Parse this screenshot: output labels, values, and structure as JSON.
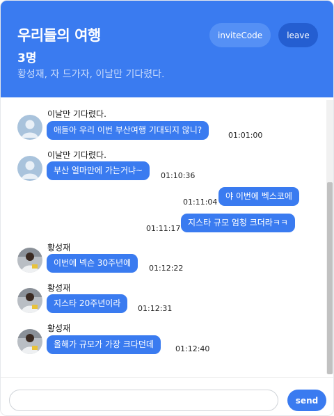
{
  "header": {
    "title": "우리들의 여행",
    "member_count": "3명",
    "members": "황성재, 자 드가자, 이날만 기다렸다.",
    "invite_label": "inviteCode",
    "leave_label": "leave"
  },
  "messages": [
    {
      "sender": "이날만 기다렸다.",
      "text": "애들아 우리 이번 부산여행 기대되지 않니?",
      "time": "01:01:00",
      "mine": false
    },
    {
      "sender": "이날만 기다렸다.",
      "text": "부산 얼마만에 가는거냐~",
      "time": "01:10:36",
      "mine": false
    },
    {
      "sender": "",
      "text": "야 이번에 벡스코에",
      "time": "01:11:04",
      "mine": true
    },
    {
      "sender": "",
      "text": "지스타 규모 엄청 크더라ㅋㅋ",
      "time": "01:11:17",
      "mine": true
    },
    {
      "sender": "황성재",
      "text": "이번에 넥슨 30주년에",
      "time": "01:12:22",
      "mine": false
    },
    {
      "sender": "황성재",
      "text": "지스타 20주년이라",
      "time": "01:12:31",
      "mine": false
    },
    {
      "sender": "황성재",
      "text": "올해가 규모가 가장 크다던데",
      "time": "01:12:40",
      "mine": false
    }
  ],
  "composer": {
    "placeholder": "",
    "send_label": "send"
  },
  "colors": {
    "accent": "#3a7bf0",
    "invite_bg": "#5590f5",
    "leave_bg": "#245ed1"
  }
}
